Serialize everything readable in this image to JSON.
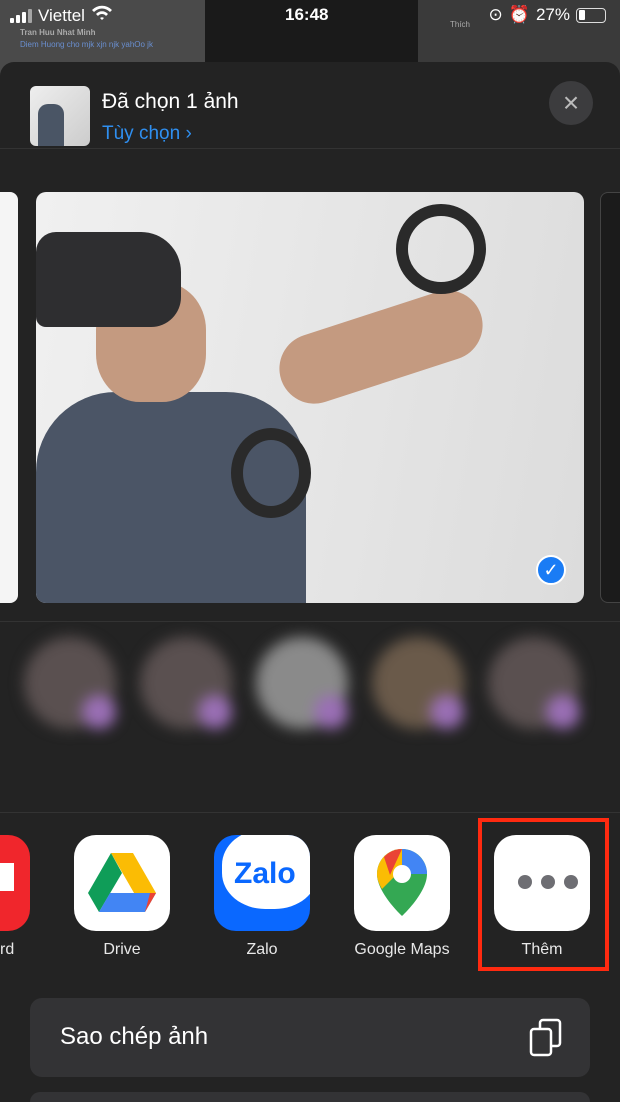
{
  "background": {
    "texts": [
      "Tran Huu Nhat Minh",
      "Diem Huong cho mjk xjn njk yahOo jk",
      "Thích"
    ]
  },
  "status_bar": {
    "carrier": "Viettel",
    "time": "16:48",
    "battery": "27%",
    "battery_level": 0.27
  },
  "header": {
    "title": "Đã chọn 1 ảnh",
    "options_label": "Tùy chọn",
    "options_chevron": "›",
    "close_icon": "×"
  },
  "photo": {
    "selected": true,
    "check_icon": "✓"
  },
  "apps": [
    {
      "label": "rd",
      "icon": "partial-red-app-icon"
    },
    {
      "label": "Drive",
      "icon": "google-drive-icon"
    },
    {
      "label": "Zalo",
      "icon": "zalo-icon",
      "icon_text": "Zalo"
    },
    {
      "label": "Google Maps",
      "icon": "google-maps-icon"
    },
    {
      "label": "Thêm",
      "icon": "more-dots-icon"
    }
  ],
  "actions": [
    {
      "label": "Sao chép ảnh",
      "icon": "copy-icon"
    }
  ],
  "colors": {
    "accent": "#2f8ff0",
    "highlight": "#ff2a10",
    "sheet": "#232323"
  }
}
